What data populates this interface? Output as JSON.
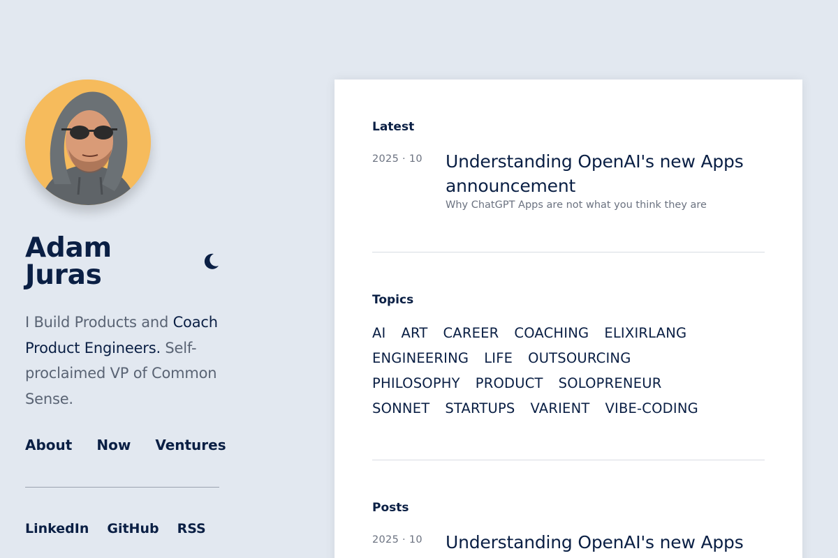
{
  "profile": {
    "name": "Adam Juras",
    "theme_toggle_icon": "moon-icon",
    "bio_prefix": "I Build Products and ",
    "bio_link": "Coach Product Engineers.",
    "bio_suffix": " Self-proclaimed VP of Common Sense."
  },
  "nav": {
    "about": "About",
    "now": "Now",
    "ventures": "Ventures"
  },
  "social": {
    "linkedin": "LinkedIn",
    "github": "GitHub",
    "rss": "RSS"
  },
  "latest": {
    "heading": "Latest",
    "date": "2025 · 10",
    "title": "Understanding OpenAI's new Apps announcement",
    "subtitle": "Why ChatGPT Apps are not what you think they are"
  },
  "topics": {
    "heading": "Topics",
    "items": [
      "AI",
      "ART",
      "CAREER",
      "COACHING",
      "ELIXIRLANG",
      "ENGINEERING",
      "LIFE",
      "OUTSOURCING",
      "PHILOSOPHY",
      "PRODUCT",
      "SOLOPRENEUR",
      "SONNET",
      "STARTUPS",
      "VARIENT",
      "VIBE-CODING"
    ]
  },
  "posts": {
    "heading": "Posts",
    "items": [
      {
        "date": "2025 · 10",
        "title": "Understanding OpenAI's new Apps"
      }
    ]
  },
  "colors": {
    "background": "#e2e8f0",
    "accent_navy": "#0a1f44",
    "avatar_bg": "#f6bb5c"
  }
}
